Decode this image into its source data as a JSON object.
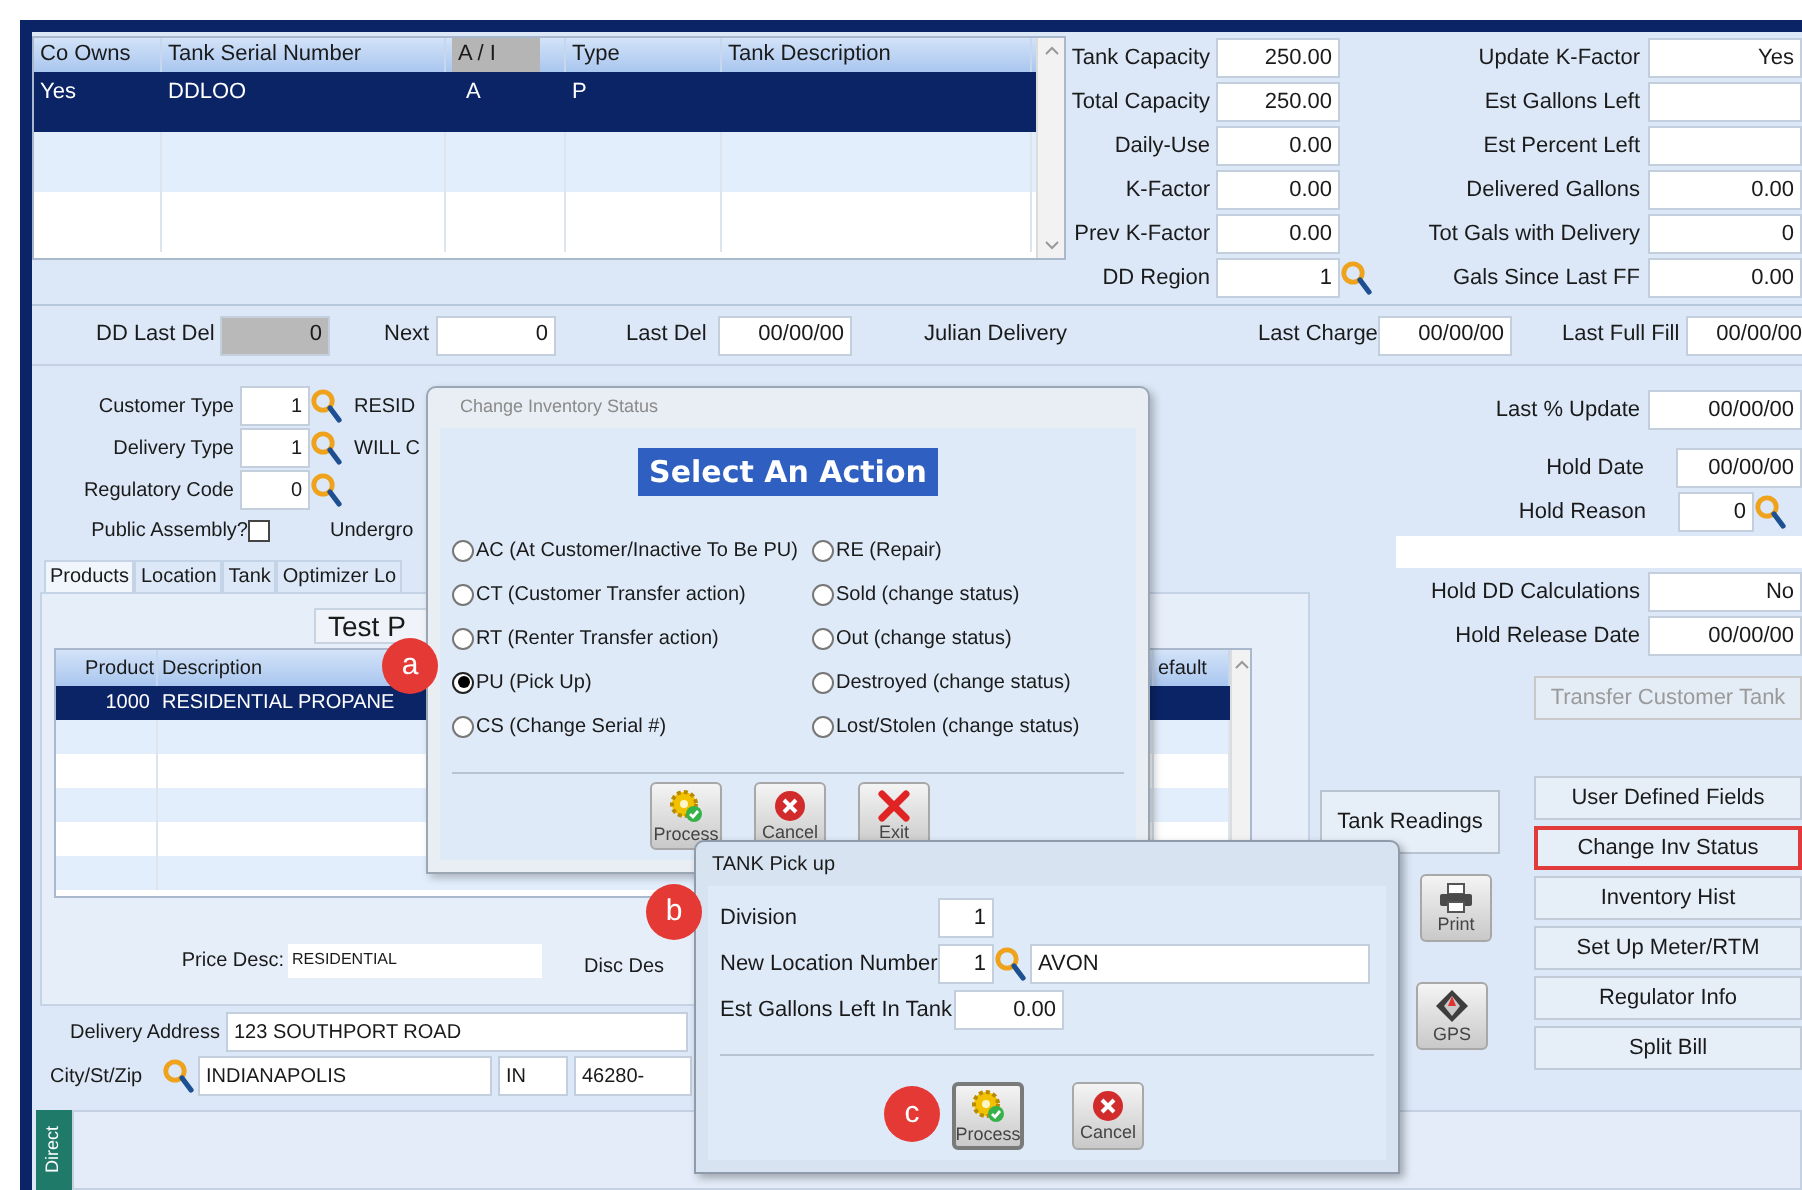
{
  "tank_grid": {
    "columns": [
      {
        "label": "Co Owns",
        "highlighted": false
      },
      {
        "label": "Tank Serial Number",
        "highlighted": false
      },
      {
        "label": "A / I",
        "highlighted": true
      },
      {
        "label": "Type",
        "highlighted": false
      },
      {
        "label": "Tank Description",
        "highlighted": false
      }
    ],
    "rows": [
      {
        "cells": [
          "Yes",
          "DDLOO",
          "A",
          "P"
        ],
        "selected": true
      }
    ]
  },
  "capacity_fields": [
    {
      "label": "Tank Capacity",
      "value": "250.00",
      "lookup": false
    },
    {
      "label": "Total Capacity",
      "value": "250.00",
      "lookup": false
    },
    {
      "label": "Daily-Use",
      "value": "0.00",
      "lookup": false
    },
    {
      "label": "K-Factor",
      "value": "0.00",
      "lookup": false
    },
    {
      "label": "Prev K-Factor",
      "value": "0.00",
      "lookup": false
    },
    {
      "label": "DD Region",
      "value": "1",
      "lookup": true
    }
  ],
  "estimate_fields": [
    {
      "label": "Update K-Factor",
      "value": "Yes"
    },
    {
      "label": "Est Gallons Left"
    },
    {
      "label": "Est Percent Left"
    },
    {
      "label": "Delivered Gallons",
      "value": "0.00"
    },
    {
      "label": "Tot Gals with Delivery",
      "value": "0"
    },
    {
      "label": "Gals Since Last FF",
      "value": "0.00"
    }
  ],
  "dates_row": [
    {
      "label": "DD Last Del",
      "value": "0",
      "disabled": true
    },
    {
      "label": "Next",
      "value": "0",
      "disabled": false
    },
    {
      "label": "Last Del",
      "value": "00/00/00",
      "disabled": false
    },
    {
      "label": "Julian Delivery"
    },
    {
      "label": "Last Charge",
      "value": "00/00/00",
      "disabled": false
    },
    {
      "label": "Last Full Fill",
      "value": "00/00/00",
      "disabled": false
    }
  ],
  "codes": [
    {
      "label": "Customer Type",
      "value": "1",
      "description": "RESID"
    },
    {
      "label": "Delivery Type",
      "value": "1",
      "description": "WILL C"
    },
    {
      "label": "Regulatory Code",
      "value": "0"
    }
  ],
  "public_assembly": {
    "label": "Public Assembly?",
    "checked": false
  },
  "underground_label": "Undergro",
  "tabs": [
    {
      "label": "Products",
      "selected": true
    },
    {
      "label": "Location",
      "selected": false
    },
    {
      "label": "Tank",
      "selected": false
    },
    {
      "label": "Optimizer Lo",
      "selected": false
    }
  ],
  "products": {
    "title": "Test P",
    "columns": [
      "Product",
      "Description",
      "efault"
    ],
    "rows": [
      {
        "cells": [
          "1000",
          "RESIDENTIAL PROPANE"
        ],
        "selected": true
      }
    ],
    "price_desc": {
      "label": "Price Desc:",
      "value": "RESIDENTIAL"
    },
    "disc_desc_label": "Disc Des"
  },
  "address": {
    "label": "Delivery Address",
    "value": "123 SOUTHPORT ROAD",
    "city_label": "City/St/Zip",
    "city": "INDIANAPOLIS",
    "state": "IN",
    "zip": "46280-"
  },
  "side_tab": "Direct",
  "hold_fields": [
    {
      "label": "Last % Update",
      "value": "00/00/00",
      "kind": "wide"
    },
    {
      "label": "Hold Date",
      "value": "00/00/00",
      "kind": "narrow"
    },
    {
      "label": "Hold Reason",
      "value": "0",
      "kind": "lookup"
    },
    {
      "kind": "blank"
    },
    {
      "label": "Hold DD Calculations",
      "value": "No",
      "kind": "wide"
    },
    {
      "label": "Hold Release Date",
      "value": "00/00/00",
      "kind": "wide"
    }
  ],
  "transfer_button": {
    "label": "Transfer Customer Tank",
    "disabled": true
  },
  "tank_readings_button": "Tank Readings",
  "icon_buttons": [
    {
      "label": "Print",
      "kind": "print"
    },
    {
      "label": "GPS",
      "kind": "gps"
    }
  ],
  "side_buttons": [
    {
      "label": "User Defined Fields",
      "highlighted": false
    },
    {
      "label": "Change Inv Status",
      "highlighted": true
    },
    {
      "label": "Inventory Hist",
      "highlighted": false
    },
    {
      "label": "Set Up Meter/RTM",
      "highlighted": false
    },
    {
      "label": "Regulator Info",
      "highlighted": false
    },
    {
      "label": "Split Bill",
      "highlighted": false
    }
  ],
  "inventory_dialog": {
    "title": "Change Inventory Status",
    "heading": "Select An Action",
    "options": [
      {
        "label": "AC (At Customer/Inactive To Be PU)",
        "selected": false
      },
      {
        "label": "CT (Customer Transfer action)",
        "selected": false
      },
      {
        "label": "RT (Renter Transfer action)",
        "selected": false
      },
      {
        "label": "PU (Pick Up)",
        "selected": true
      },
      {
        "label": "CS (Change Serial #)",
        "selected": false
      },
      {
        "label": "RE (Repair)",
        "selected": false
      },
      {
        "label": "Sold (change status)",
        "selected": false
      },
      {
        "label": "Out (change status)",
        "selected": false
      },
      {
        "label": "Destroyed (change status)",
        "selected": false
      },
      {
        "label": "Lost/Stolen (change status)",
        "selected": false
      }
    ],
    "buttons": [
      {
        "label": "Process",
        "kind": "process",
        "focused": false
      },
      {
        "label": "Cancel",
        "kind": "cancel",
        "focused": false
      },
      {
        "label": "Exit",
        "kind": "exit",
        "focused": false
      }
    ]
  },
  "pickup_dialog": {
    "title": "TANK Pick up",
    "division": {
      "label": "Division",
      "value": "1"
    },
    "location": {
      "label": "New Location Number",
      "value": "1",
      "name": "AVON"
    },
    "gallons": {
      "label": "Est Gallons Left In Tank",
      "value": "0.00"
    },
    "buttons": [
      {
        "label": "Process",
        "kind": "process",
        "focused": true
      },
      {
        "label": "Cancel",
        "kind": "cancel",
        "focused": false
      }
    ]
  },
  "callouts": [
    {
      "label": "a"
    },
    {
      "label": "b"
    },
    {
      "label": "c"
    }
  ]
}
